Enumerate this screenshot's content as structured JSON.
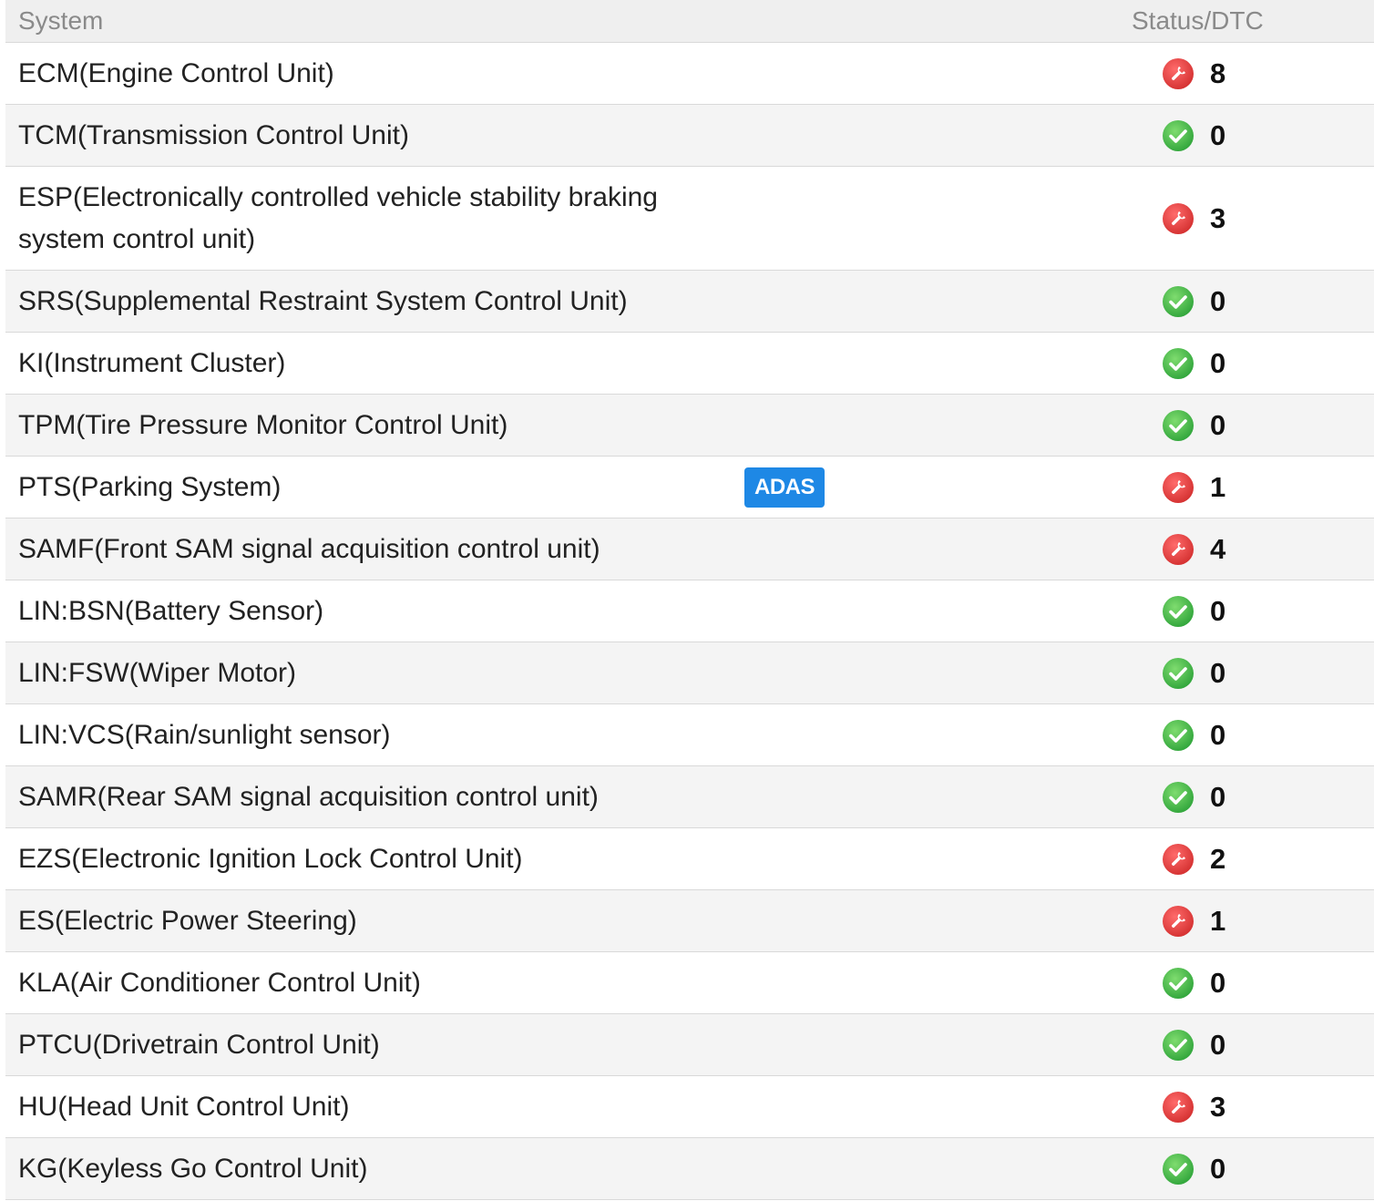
{
  "header": {
    "system": "System",
    "status": "Status/DTC"
  },
  "rows": [
    {
      "name": "ECM(Engine Control Unit)",
      "status": "fault",
      "count": "8"
    },
    {
      "name": "TCM(Transmission Control Unit)",
      "status": "ok",
      "count": "0"
    },
    {
      "name": "ESP(Electronically controlled vehicle stability braking system control unit)",
      "status": "fault",
      "count": "3"
    },
    {
      "name": "SRS(Supplemental Restraint System Control Unit)",
      "status": "ok",
      "count": "0"
    },
    {
      "name": "KI(Instrument Cluster)",
      "status": "ok",
      "count": "0"
    },
    {
      "name": "TPM(Tire Pressure Monitor Control Unit)",
      "status": "ok",
      "count": "0"
    },
    {
      "name": "PTS(Parking System)",
      "status": "fault",
      "count": "1",
      "badge": "ADAS"
    },
    {
      "name": "SAMF(Front SAM signal acquisition control unit)",
      "status": "fault",
      "count": "4"
    },
    {
      "name": "LIN:BSN(Battery Sensor)",
      "status": "ok",
      "count": "0"
    },
    {
      "name": "LIN:FSW(Wiper Motor)",
      "status": "ok",
      "count": "0"
    },
    {
      "name": "LIN:VCS(Rain/sunlight sensor)",
      "status": "ok",
      "count": "0"
    },
    {
      "name": "SAMR(Rear SAM signal acquisition control unit)",
      "status": "ok",
      "count": "0"
    },
    {
      "name": "EZS(Electronic Ignition Lock Control Unit)",
      "status": "fault",
      "count": "2"
    },
    {
      "name": "ES(Electric Power Steering)",
      "status": "fault",
      "count": "1"
    },
    {
      "name": "KLA(Air Conditioner Control Unit)",
      "status": "ok",
      "count": "0"
    },
    {
      "name": "PTCU(Drivetrain Control Unit)",
      "status": "ok",
      "count": "0"
    },
    {
      "name": "HU(Head Unit Control Unit)",
      "status": "fault",
      "count": "3"
    },
    {
      "name": "KG(Keyless Go Control Unit)",
      "status": "ok",
      "count": "0"
    }
  ],
  "icons": {
    "ok": "check-circle-icon",
    "fault": "wrench-icon"
  },
  "colors": {
    "ok": "#4cbb4c",
    "fault": "#e53935",
    "badge": "#1e88e5"
  }
}
